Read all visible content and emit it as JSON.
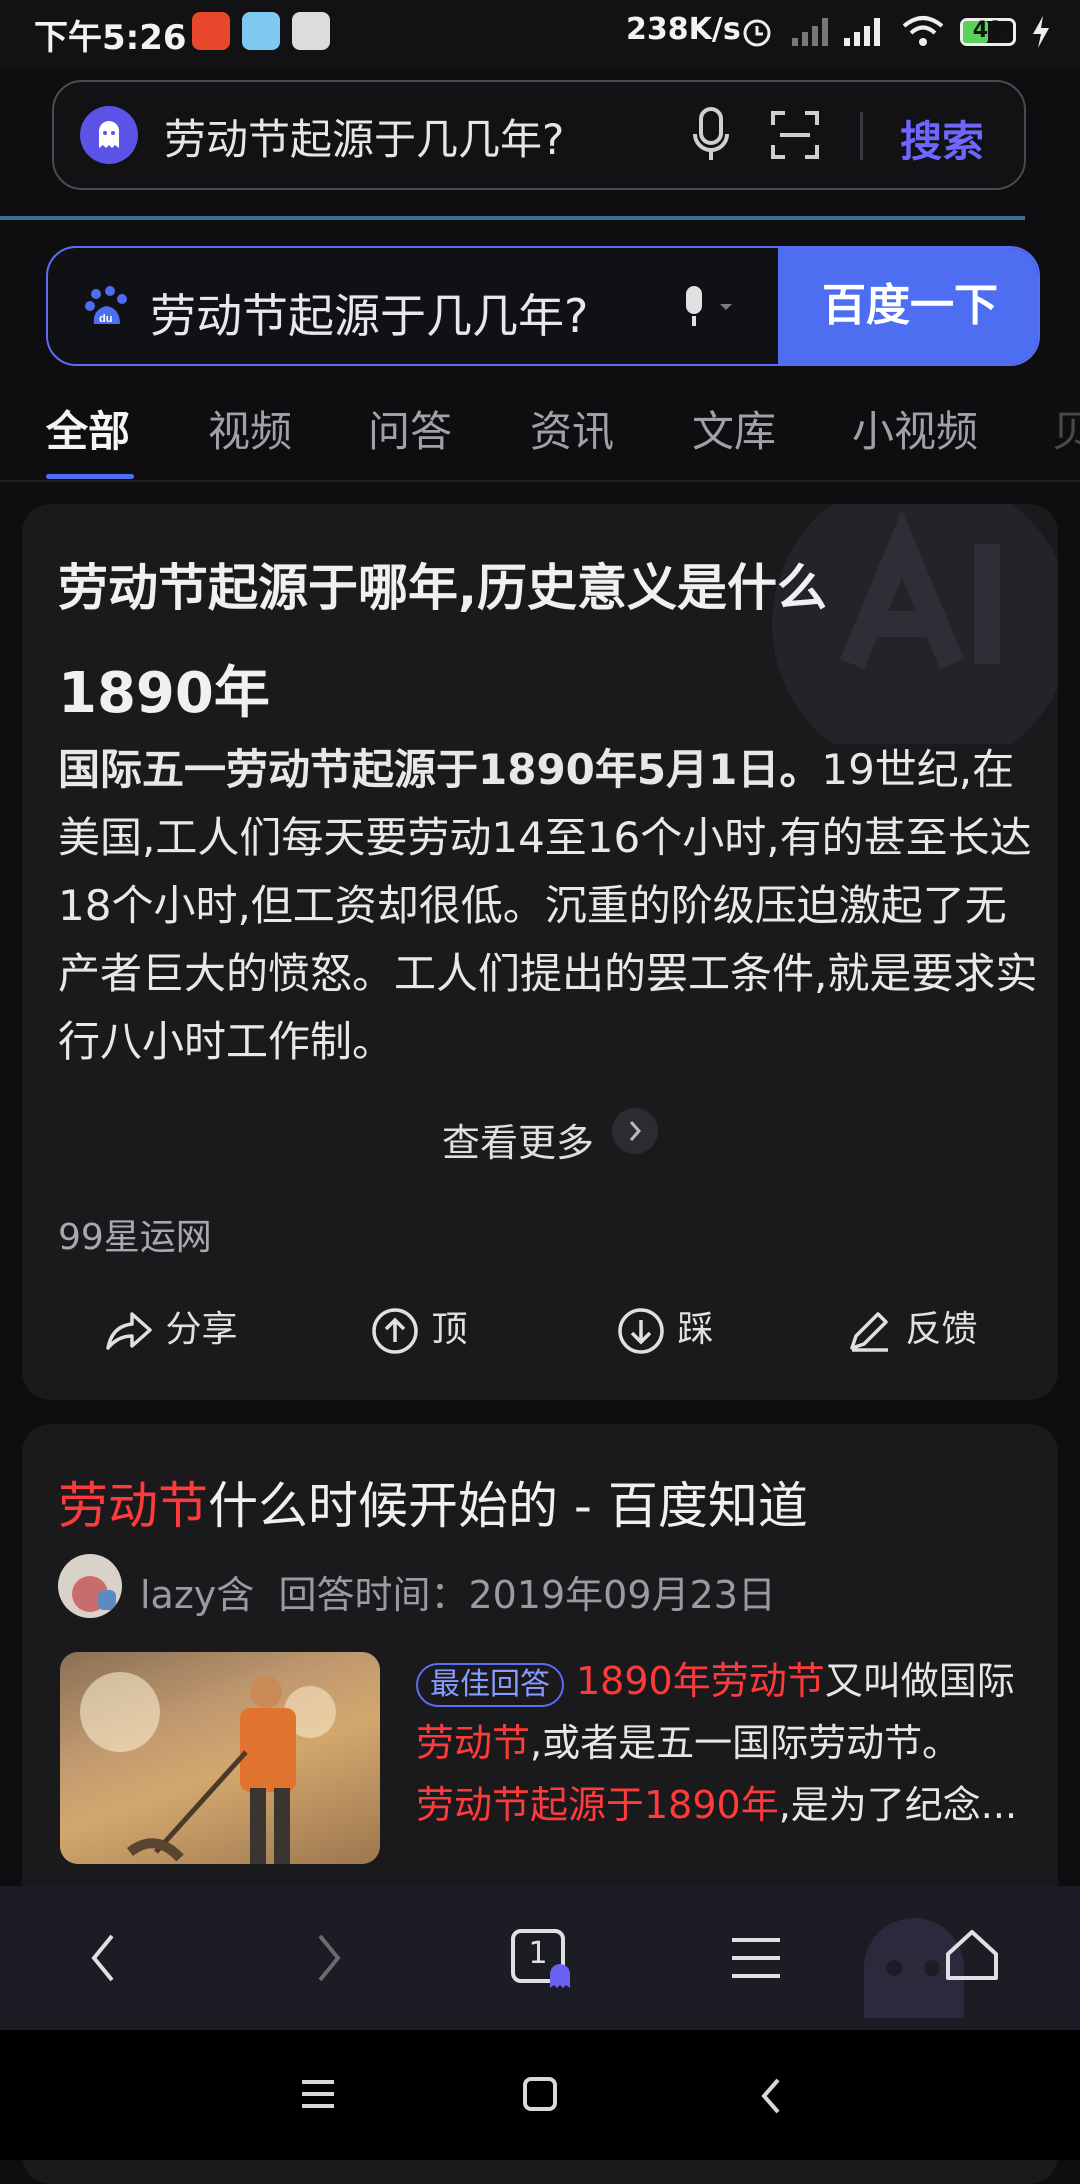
{
  "status_bar": {
    "time": "下午5:26",
    "network_speed": "238K/s",
    "battery": "49",
    "battery_level": 0.49
  },
  "browser_bar": {
    "query": "劳动节起源于几几年?",
    "search_label": "搜索"
  },
  "baidu": {
    "query": "劳动节起源于几几年?",
    "button_label": "百度一下"
  },
  "tabs": [
    "全部",
    "视频",
    "问答",
    "资讯",
    "文库",
    "小视频",
    "贝"
  ],
  "ai_card": {
    "title": "劳动节起源于哪年,历史意义是什么",
    "year": "1890年",
    "body_bold": "国际五一劳动节起源于1890年5月1日。",
    "body_rest": "19世纪,在美国,工人们每天要劳动14至16个小时,有的甚至长达18个小时,但工资却很低。沉重的阶级压迫激起了无产者巨大的愤怒。工人们提出的罢工条件,就是要求实行八小时工作制。",
    "view_more": "查看更多",
    "source": "99星运网",
    "actions": {
      "share": "分享",
      "up": "顶",
      "down": "踩",
      "feedback": "反馈"
    }
  },
  "result": {
    "title_highlight": "劳动节",
    "title_rest": "什么时候开始的 - 百度知道",
    "user": "lazy含",
    "answer_time": "回答时间：2019年09月23日",
    "badge": "最佳回答",
    "snip1_red": "1890年劳动节",
    "snip1": "又叫做国际",
    "snip2_red": "劳动节",
    "snip2": ",或者是五一国际劳动节。",
    "snip3_red": "劳动节起源于1890年",
    "snip3": ",是为了纪念..."
  },
  "bottom_nav": {
    "tab_count": "1"
  },
  "colors": {
    "accent": "#4e6ef2",
    "highlight": "#ff3a3a",
    "brand_purple": "#5b53e6"
  }
}
